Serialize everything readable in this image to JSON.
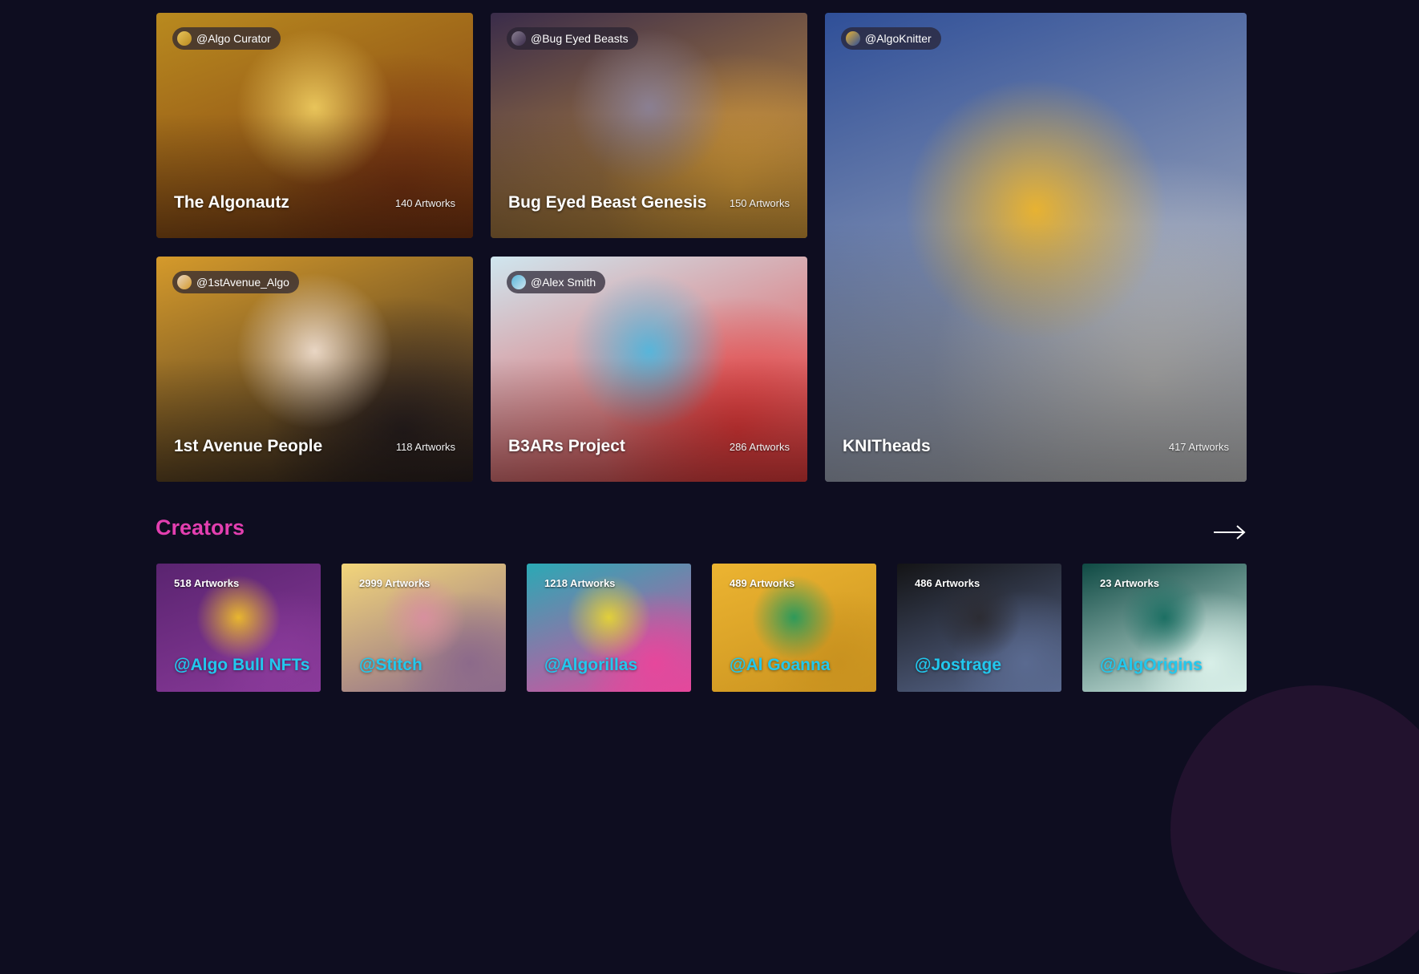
{
  "collections": [
    {
      "creator": "@Algo Curator",
      "title": "The Algonautz",
      "count": "140 Artworks",
      "art": "astronaut-angel-art",
      "colors": [
        "#b98a1f",
        "#e8c45a",
        "#7a3512"
      ]
    },
    {
      "creator": "@Bug Eyed Beasts",
      "title": "Bug Eyed Beast Genesis",
      "count": "150 Artworks",
      "art": "helmet-creature-art",
      "colors": [
        "#3a2c4a",
        "#8a7f92",
        "#d89d3a"
      ]
    },
    {
      "creator": "@AlgoKnitter",
      "title": "KNITheads",
      "count": "417 Artworks",
      "art": "knitted-frog-art",
      "colors": [
        "#2f4f98",
        "#e7b232",
        "#c9c9c9"
      ]
    },
    {
      "creator": "@1stAvenue_Algo",
      "title": "1st Avenue People",
      "count": "118 Artworks",
      "art": "pixel-man-art",
      "colors": [
        "#d59a2b",
        "#e9d6c4",
        "#2a2020"
      ]
    },
    {
      "creator": "@Alex Smith",
      "title": "B3ARs Project",
      "count": "286 Artworks",
      "art": "blue-bear-art",
      "colors": [
        "#cfe6ef",
        "#58b5da",
        "#e53a3a"
      ]
    }
  ],
  "creators_section": {
    "title": "Creators"
  },
  "creators": [
    {
      "count": "518 Artworks",
      "handle": "@Algo Bull NFTs",
      "art": "bull-art",
      "colors": [
        "#5a2470",
        "#e8b62f",
        "#8a3a9a"
      ]
    },
    {
      "count": "2999 Artworks",
      "handle": "@Stitch",
      "art": "bird-art",
      "colors": [
        "#f2d57a",
        "#d7909e",
        "#8c6a8a"
      ]
    },
    {
      "count": "1218 Artworks",
      "handle": "@Algorillas",
      "art": "gorilla-art",
      "colors": [
        "#2aa9b5",
        "#e1d03a",
        "#e6479c"
      ]
    },
    {
      "count": "489 Artworks",
      "handle": "@Al Goanna",
      "art": "lizard-art",
      "colors": [
        "#ecb431",
        "#2e9a5a",
        "#c9921f"
      ]
    },
    {
      "count": "486 Artworks",
      "handle": "@Jostrage",
      "art": "figure-art",
      "colors": [
        "#141416",
        "#2c2c33",
        "#5a6a90"
      ]
    },
    {
      "count": "23 Artworks",
      "handle": "@AlgOrigins",
      "art": "ocean-art",
      "colors": [
        "#0f4a44",
        "#1c6f63",
        "#d8efe8"
      ]
    }
  ]
}
